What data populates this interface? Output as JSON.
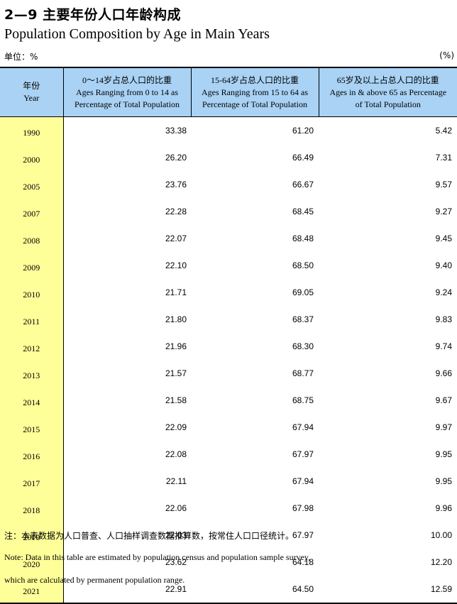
{
  "title_cn": "2—9  主要年份人口年龄构成",
  "title_en": "Population Composition by Age in Main Years",
  "unit_cn": "单位：%",
  "unit_en": "(%)",
  "headers": [
    {
      "cn": "年份",
      "en": "Year"
    },
    {
      "cn": "0～14岁占总人口的比重",
      "en1": "Ages Ranging from 0 to 14 as",
      "en2": "Percentage of Total Population"
    },
    {
      "cn": "15-64岁占总人口的比重",
      "en1": "Ages Ranging from 15 to 64 as",
      "en2": "Percentage of Total Population"
    },
    {
      "cn": "65岁及以上占总人口的比重",
      "en1": "Ages in & above 65 as Percentage",
      "en2": "of Total Population"
    }
  ],
  "rows": [
    {
      "year": "1990",
      "a": "33.38",
      "b": "61.20",
      "c": "5.42"
    },
    {
      "year": "2000",
      "a": "26.20",
      "b": "66.49",
      "c": "7.31"
    },
    {
      "year": "2005",
      "a": "23.76",
      "b": "66.67",
      "c": "9.57"
    },
    {
      "year": "2007",
      "a": "22.28",
      "b": "68.45",
      "c": "9.27"
    },
    {
      "year": "2008",
      "a": "22.07",
      "b": "68.48",
      "c": "9.45"
    },
    {
      "year": "2009",
      "a": "22.10",
      "b": "68.50",
      "c": "9.40"
    },
    {
      "year": "2010",
      "a": "21.71",
      "b": "69.05",
      "c": "9.24"
    },
    {
      "year": "2011",
      "a": "21.80",
      "b": "68.37",
      "c": "9.83"
    },
    {
      "year": "2012",
      "a": "21.96",
      "b": "68.30",
      "c": "9.74"
    },
    {
      "year": "2013",
      "a": "21.57",
      "b": "68.77",
      "c": "9.66"
    },
    {
      "year": "2014",
      "a": "21.58",
      "b": "68.75",
      "c": "9.67"
    },
    {
      "year": "2015",
      "a": "22.09",
      "b": "67.94",
      "c": "9.97"
    },
    {
      "year": "2016",
      "a": "22.08",
      "b": "67.97",
      "c": "9.95"
    },
    {
      "year": "2017",
      "a": "22.11",
      "b": "67.94",
      "c": "9.95"
    },
    {
      "year": "2018",
      "a": "22.06",
      "b": "67.98",
      "c": "9.96"
    },
    {
      "year": "2019",
      "a": "22.03",
      "b": "67.97",
      "c": "10.00"
    },
    {
      "year": "2020",
      "a": "23.62",
      "b": "64.18",
      "c": "12.20"
    },
    {
      "year": "2021",
      "a": "22.91",
      "b": "64.50",
      "c": "12.59"
    }
  ],
  "note_cn": "注：本表数据为人口普查、人口抽样调查数据推算数，按常住人口口径统计。",
  "note_en_1": "Note:  Data in this table are estimated by population census and population sample survey,",
  "note_en_2": "which are calculated by permanent population range.",
  "colors": {
    "header_bg": "#a9d2f4",
    "year_bg": "#ffff99"
  }
}
